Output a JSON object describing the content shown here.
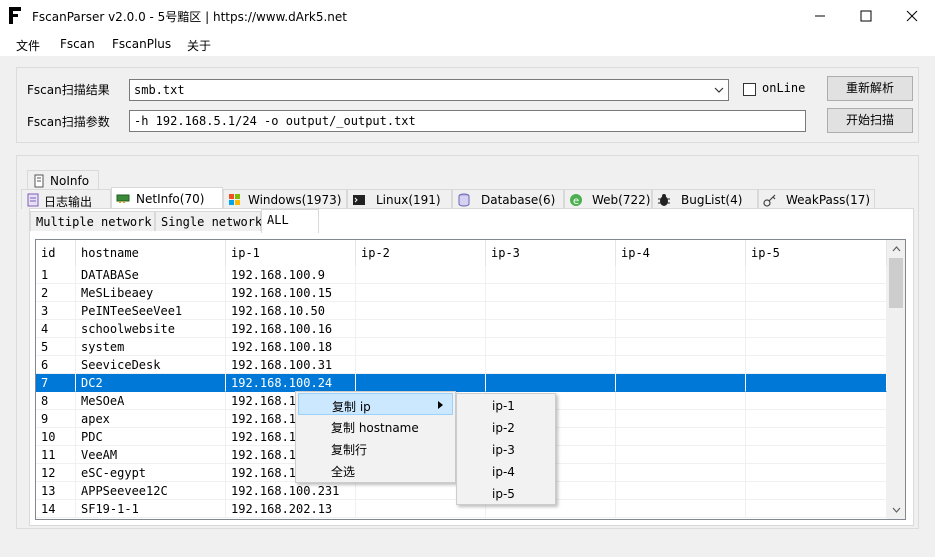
{
  "window": {
    "title": "FscanParser v2.0.0 - 5号黯区 | https://www.dArk5.net",
    "logo_icon": "fscanparser-logo-icon"
  },
  "menu": [
    "文件",
    "Fscan",
    "FscanPlus",
    "关于"
  ],
  "form": {
    "result_label": "Fscan扫描结果",
    "result_file": "smb.txt",
    "online_label": "onLine",
    "online_checked": false,
    "reparse_button": "重新解析",
    "params_label": "Fscan扫描参数",
    "params_value": "-h 192.168.5.1/24 -o output/_output.txt",
    "start_button": "开始扫描"
  },
  "tabs_row1": [
    {
      "label": "NoInfo",
      "icon": "document-icon"
    }
  ],
  "tabs_row2": [
    {
      "label": "日志输出",
      "icon": "log-icon"
    },
    {
      "label": "NetInfo(70)",
      "icon": "network-card-icon",
      "active": true
    },
    {
      "label": "Windows(1973)",
      "icon": "windows-icon"
    },
    {
      "label": "Linux(191)",
      "icon": "terminal-icon"
    },
    {
      "label": "Database(6)",
      "icon": "database-icon"
    },
    {
      "label": "Web(722)",
      "icon": "web-icon"
    },
    {
      "label": "BugList(4)",
      "icon": "bug-icon"
    },
    {
      "label": "WeakPass(17)",
      "icon": "key-icon"
    }
  ],
  "subtabs": [
    {
      "label": "Multiple network"
    },
    {
      "label": "Single network"
    },
    {
      "label": "ALL",
      "active": true
    }
  ],
  "grid": {
    "columns": [
      "id",
      "hostname",
      "ip-1",
      "ip-2",
      "ip-3",
      "ip-4",
      "ip-5"
    ],
    "rows": [
      [
        "1",
        "DATABASe",
        "192.168.100.9"
      ],
      [
        "2",
        "MeSLibeaey",
        "192.168.100.15"
      ],
      [
        "3",
        "PeINTeeSeeVee1",
        "192.168.10.50"
      ],
      [
        "4",
        "schoolwebsite",
        "192.168.100.16"
      ],
      [
        "5",
        "system",
        "192.168.100.18"
      ],
      [
        "6",
        "SeeviceDesk",
        "192.168.100.31"
      ],
      [
        "7",
        "DC2",
        "192.168.100.24"
      ],
      [
        "8",
        "MeSOeA",
        "192.168.1"
      ],
      [
        "9",
        "apex",
        "192.168.1"
      ],
      [
        "10",
        "PDC",
        "192.168.1"
      ],
      [
        "11",
        "VeeAM",
        "192.168.1"
      ],
      [
        "12",
        "eSC-egypt",
        "192.168.1"
      ],
      [
        "13",
        "APPSeevee12C",
        "192.168.100.231"
      ],
      [
        "14",
        "SF19-1-1",
        "192.168.202.13"
      ]
    ],
    "selected_row": "7"
  },
  "context_menu": {
    "items": [
      "复制 ip",
      "复制 hostname",
      "复制行",
      "全选"
    ],
    "highlighted": "复制 ip"
  },
  "submenu": {
    "items": [
      "ip-1",
      "ip-2",
      "ip-3",
      "ip-4",
      "ip-5"
    ]
  },
  "colors": {
    "selection": "#0078d7",
    "menu_highlight": "#cce8ff"
  }
}
